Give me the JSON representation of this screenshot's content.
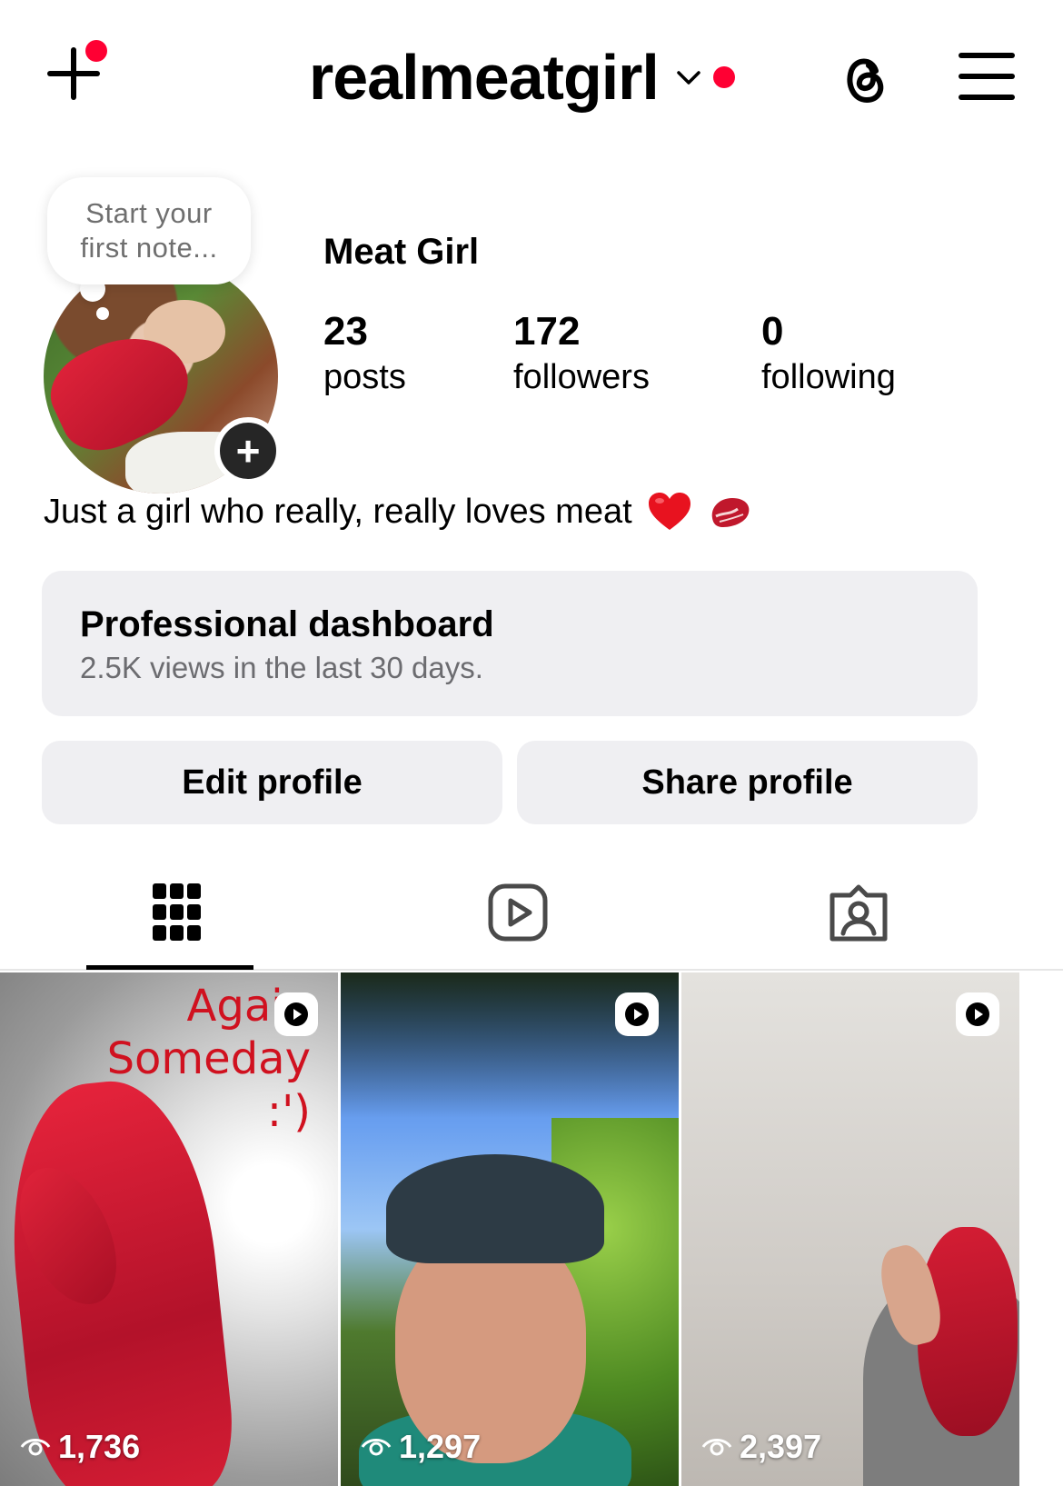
{
  "header": {
    "username": "realmeatgirl",
    "notification_color": "#ff0033"
  },
  "profile": {
    "note_placeholder_line1": "Start your",
    "note_placeholder_line2": "first note...",
    "display_name": "Meat Girl",
    "stats": [
      {
        "value": "23",
        "label": "posts"
      },
      {
        "value": "172",
        "label": "followers"
      },
      {
        "value": "0",
        "label": "following"
      }
    ],
    "bio": "Just a girl who really, really loves meat",
    "bio_emojis": [
      "heart-emoji",
      "steak-emoji"
    ]
  },
  "dashboard": {
    "title": "Professional dashboard",
    "subtitle": "2.5K views in the last 30 days."
  },
  "actions": {
    "edit_label": "Edit profile",
    "share_label": "Share profile"
  },
  "tabs": [
    {
      "icon": "grid-icon",
      "active": true
    },
    {
      "icon": "reels-icon",
      "active": false
    },
    {
      "icon": "tagged-icon",
      "active": false
    }
  ],
  "posts": [
    {
      "views": "1,736",
      "overlay_text_line1": "Again",
      "overlay_text_line2": "Someday",
      "overlay_text_line3": ":')",
      "type": "reel"
    },
    {
      "views": "1,297",
      "type": "reel"
    },
    {
      "views": "2,397",
      "type": "reel"
    }
  ]
}
